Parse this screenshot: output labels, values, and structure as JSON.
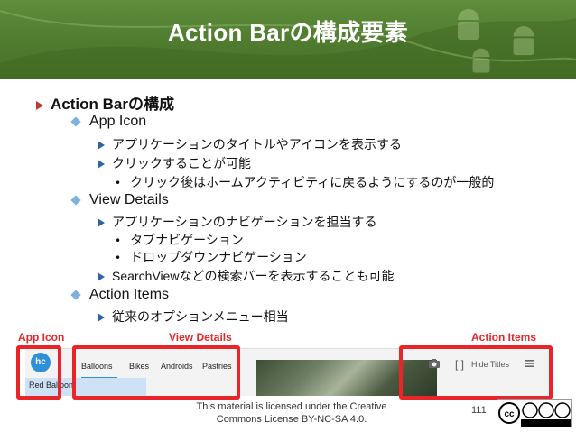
{
  "slide": {
    "title": "Action Barの構成要素",
    "page_number": "111",
    "license": [
      "This material is licensed under the Creative",
      "Commons License BY-NC-SA 4.0."
    ],
    "accent_color": "#4f7b2f",
    "callout_color": "#e8262a"
  },
  "outline": {
    "heading": "Action Barの構成",
    "sections": [
      {
        "label": "App Icon",
        "points": [
          "アプリケーションのタイトルやアイコンを表示する",
          "クリックすることが可能"
        ],
        "subpoint": "クリック後はホームアクティビティに戻るようにするのが一般的"
      },
      {
        "label": "View Details",
        "points": [
          "アプリケーションのナビゲーションを担当する",
          "SearchViewなどの検索バーを表示することも可能"
        ],
        "subpoints": [
          "タブナビゲーション",
          "ドロップダウンナビゲーション"
        ]
      },
      {
        "label": "Action Items",
        "points": [
          "従来のオプションメニュー相当"
        ]
      }
    ]
  },
  "screenshot": {
    "labels": {
      "app_icon": "App Icon",
      "view_details": "View Details",
      "action_items": "Action Items"
    },
    "logo_text": "hc",
    "tabs": [
      "Balloons",
      "Bikes",
      "Androids",
      "Pastries"
    ],
    "selected_item": "Red Balloon",
    "action_label": "Hide Titles"
  },
  "icons": [
    "android-robot-icon",
    "triangle-bullet-icon",
    "diamond-bullet-icon",
    "camera-icon",
    "overflow-menu-icon",
    "cc-license-icon"
  ]
}
